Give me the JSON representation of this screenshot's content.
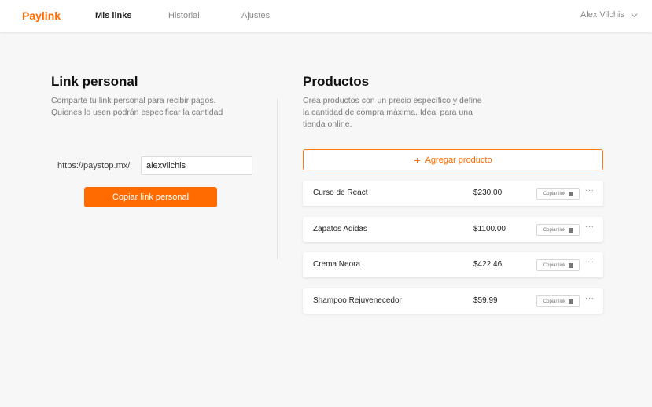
{
  "nav": {
    "logo": "Paylink",
    "items": [
      {
        "label": "Mis links",
        "active": true
      },
      {
        "label": "Historial",
        "active": false
      },
      {
        "label": "Ajustes",
        "active": false
      }
    ],
    "user_name": "Alex Vilchis"
  },
  "personal": {
    "title": "Link personal",
    "desc_line1": "Comparte tu link personal para recibir pagos.",
    "desc_line2": "Quienes lo usen podrán especificar la cantidad",
    "url_prefix": "https://paystop.mx/",
    "username_value": "alexvilchis",
    "copy_button": "Copiar link personal"
  },
  "products": {
    "title": "Productos",
    "desc_line1": "Crea productos con un precio específico y define",
    "desc_line2": "la cantidad de compra máxima. Ideal para una",
    "desc_line3": "tienda online.",
    "add_button": "Agregar producto",
    "copy_label": "Copiar link",
    "more_label": "···",
    "items": [
      {
        "name": "Curso de React",
        "price": "$230.00"
      },
      {
        "name": "Zapatos Adidas",
        "price": "$1100.00"
      },
      {
        "name": "Crema Neora",
        "price": "$422.46"
      },
      {
        "name": "Shampoo Rejuvenecedor",
        "price": "$59.99"
      }
    ]
  },
  "colors": {
    "accent": "#ff6b00",
    "background": "#f7f7f7"
  }
}
